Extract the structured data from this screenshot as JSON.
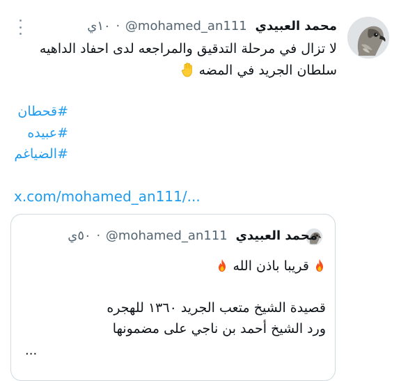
{
  "tweet": {
    "author": {
      "display_name": "محمد العبيدي",
      "handle": "@mohamed_an111",
      "separator": "·",
      "time": "١٠ي"
    },
    "text_lines": [
      "لا تزال في مرحلة التدقيق والمراجعه لدى احفاد الداهيه",
      "سلطان الجريد في المضه"
    ],
    "hashtags": [
      "#قحطان",
      "#عبيده",
      "#الضياغم"
    ],
    "link_text": "x.com/mohamed_an111/...",
    "icons": {
      "more": "more-options-icon",
      "inline": "raised-hand-emoji-icon"
    }
  },
  "quoted_tweet": {
    "author": {
      "display_name": "محمد العبيدي",
      "handle": "@mohamed_an111",
      "separator": "·",
      "time": "٥٠ي"
    },
    "line1": "قريبا باذن الله",
    "line2": "قصيدة الشيخ متعب الجريد ١٣٦٠ للهجره",
    "line3": "ورد الشيخ أحمد بن ناجي على مضمونها",
    "ellipsis": "...",
    "icons": {
      "fire": "fire-emoji-icon"
    }
  },
  "colors": {
    "link": "#1d9bf0",
    "text": "#0f1419",
    "secondary": "#536471",
    "border": "#cfd9de"
  }
}
